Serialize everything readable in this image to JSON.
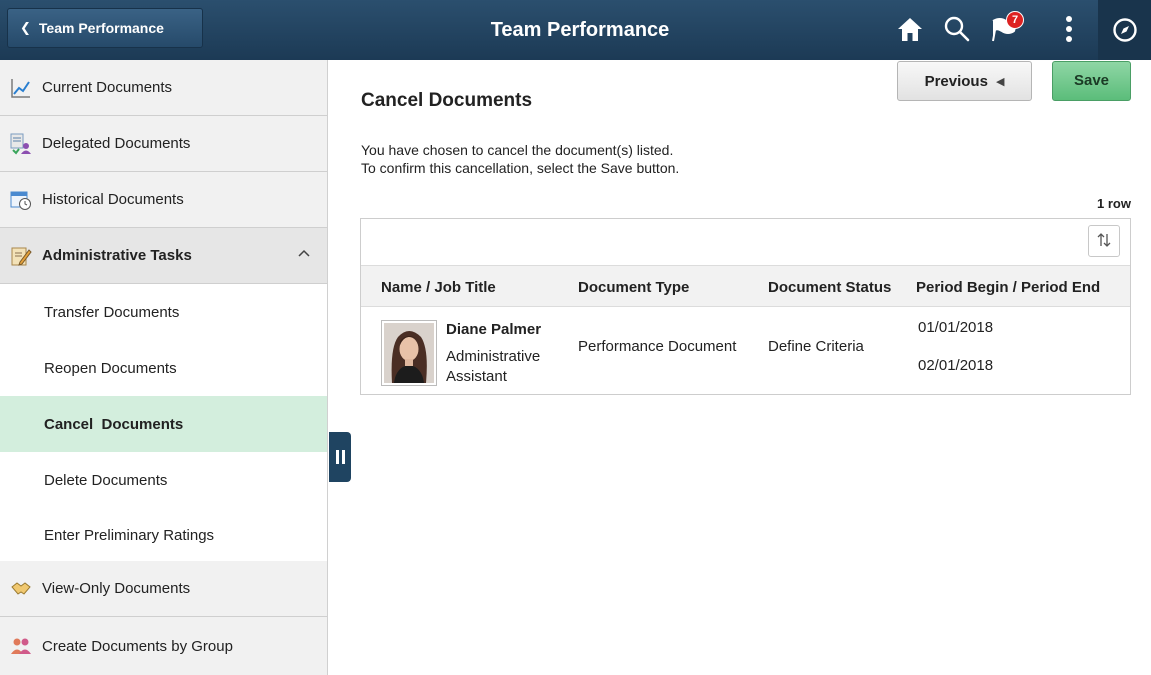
{
  "header": {
    "back_label": "Team Performance",
    "title": "Team Performance",
    "notification_count": "7",
    "icons": [
      "home-icon",
      "search-icon",
      "flag-icon",
      "more-actions-icon",
      "navbar-compass-icon"
    ]
  },
  "sidebar": {
    "items": [
      {
        "label": "Current Documents",
        "icon": "chart-line-icon"
      },
      {
        "label": "Delegated Documents",
        "icon": "delegate-icon"
      },
      {
        "label": "Historical Documents",
        "icon": "calendar-clock-icon"
      },
      {
        "label": "Administrative Tasks",
        "icon": "clipboard-edit-icon"
      },
      {
        "label": "View-Only Documents",
        "icon": "handshake-icon"
      },
      {
        "label": "Create Documents by Group",
        "icon": "group-users-icon"
      }
    ],
    "sub_items": [
      {
        "label": "Transfer Documents"
      },
      {
        "label": "Reopen Documents"
      },
      {
        "label": "Cancel  Documents",
        "active": true
      },
      {
        "label": "Delete Documents"
      },
      {
        "label": "Enter Preliminary Ratings"
      }
    ]
  },
  "main": {
    "title": "Cancel Documents",
    "previous_label": "Previous",
    "save_label": "Save",
    "instruction_line1": "You have chosen to cancel the document(s) listed.",
    "instruction_line2": "To confirm this cancellation, select the Save button.",
    "row_count": "1 row",
    "columns": [
      "Name / Job Title",
      "Document Type",
      "Document Status",
      "Period Begin / Period End"
    ],
    "rows": [
      {
        "name": "Diane Palmer",
        "job_title_line1": "Administrative",
        "job_title_line2": "Assistant",
        "document_type": "Performance Document",
        "document_status": "Define Criteria",
        "period_begin": "01/01/2018",
        "period_end": "02/01/2018"
      }
    ]
  },
  "colors": {
    "header_bg": "#1f4461",
    "active_item_bg": "#d3eedd",
    "save_button": "#6cc489",
    "badge": "#dd2222"
  }
}
